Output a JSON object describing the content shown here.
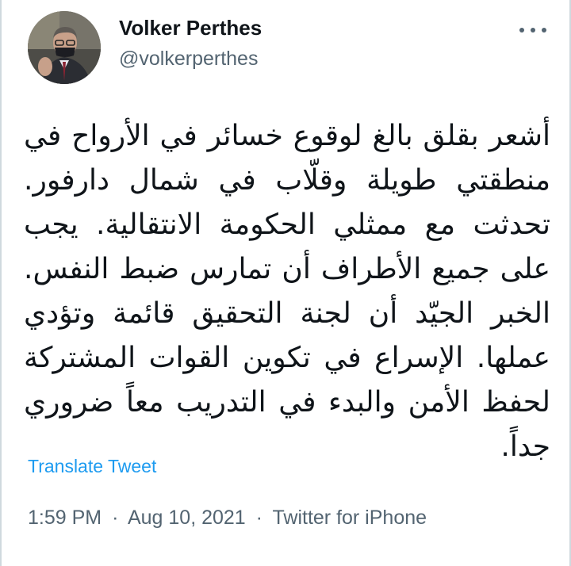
{
  "tweet": {
    "author": {
      "name": "Volker Perthes",
      "handle": "@volkerperthes",
      "avatar_icon": "profile-photo"
    },
    "more_icon": "ellipsis-icon",
    "text": "أشعر بقلق بالغ لوقوع خسائر في الأرواح في منطقتي طويلة وقلّاب في شمال دارفور. تحدثت مع ممثلي الحكومة الانتقالية. يجب على جميع الأطراف أن تمارس ضبط النفس. الخبر الجيّد أن لجنة التحقيق قائمة وتؤدي عملها. الإسراع في تكوين القوات المشتركة لحفظ الأمن والبدء في التدريب معاً ضروري جداً.",
    "translate_label": "Translate Tweet",
    "time": "1:59 PM",
    "separator": "·",
    "date": "Aug 10, 2021",
    "source": "Twitter for iPhone"
  },
  "colors": {
    "text": "#0f1419",
    "secondary": "#536471",
    "link": "#1d9bf0",
    "border": "#cfd9de"
  }
}
